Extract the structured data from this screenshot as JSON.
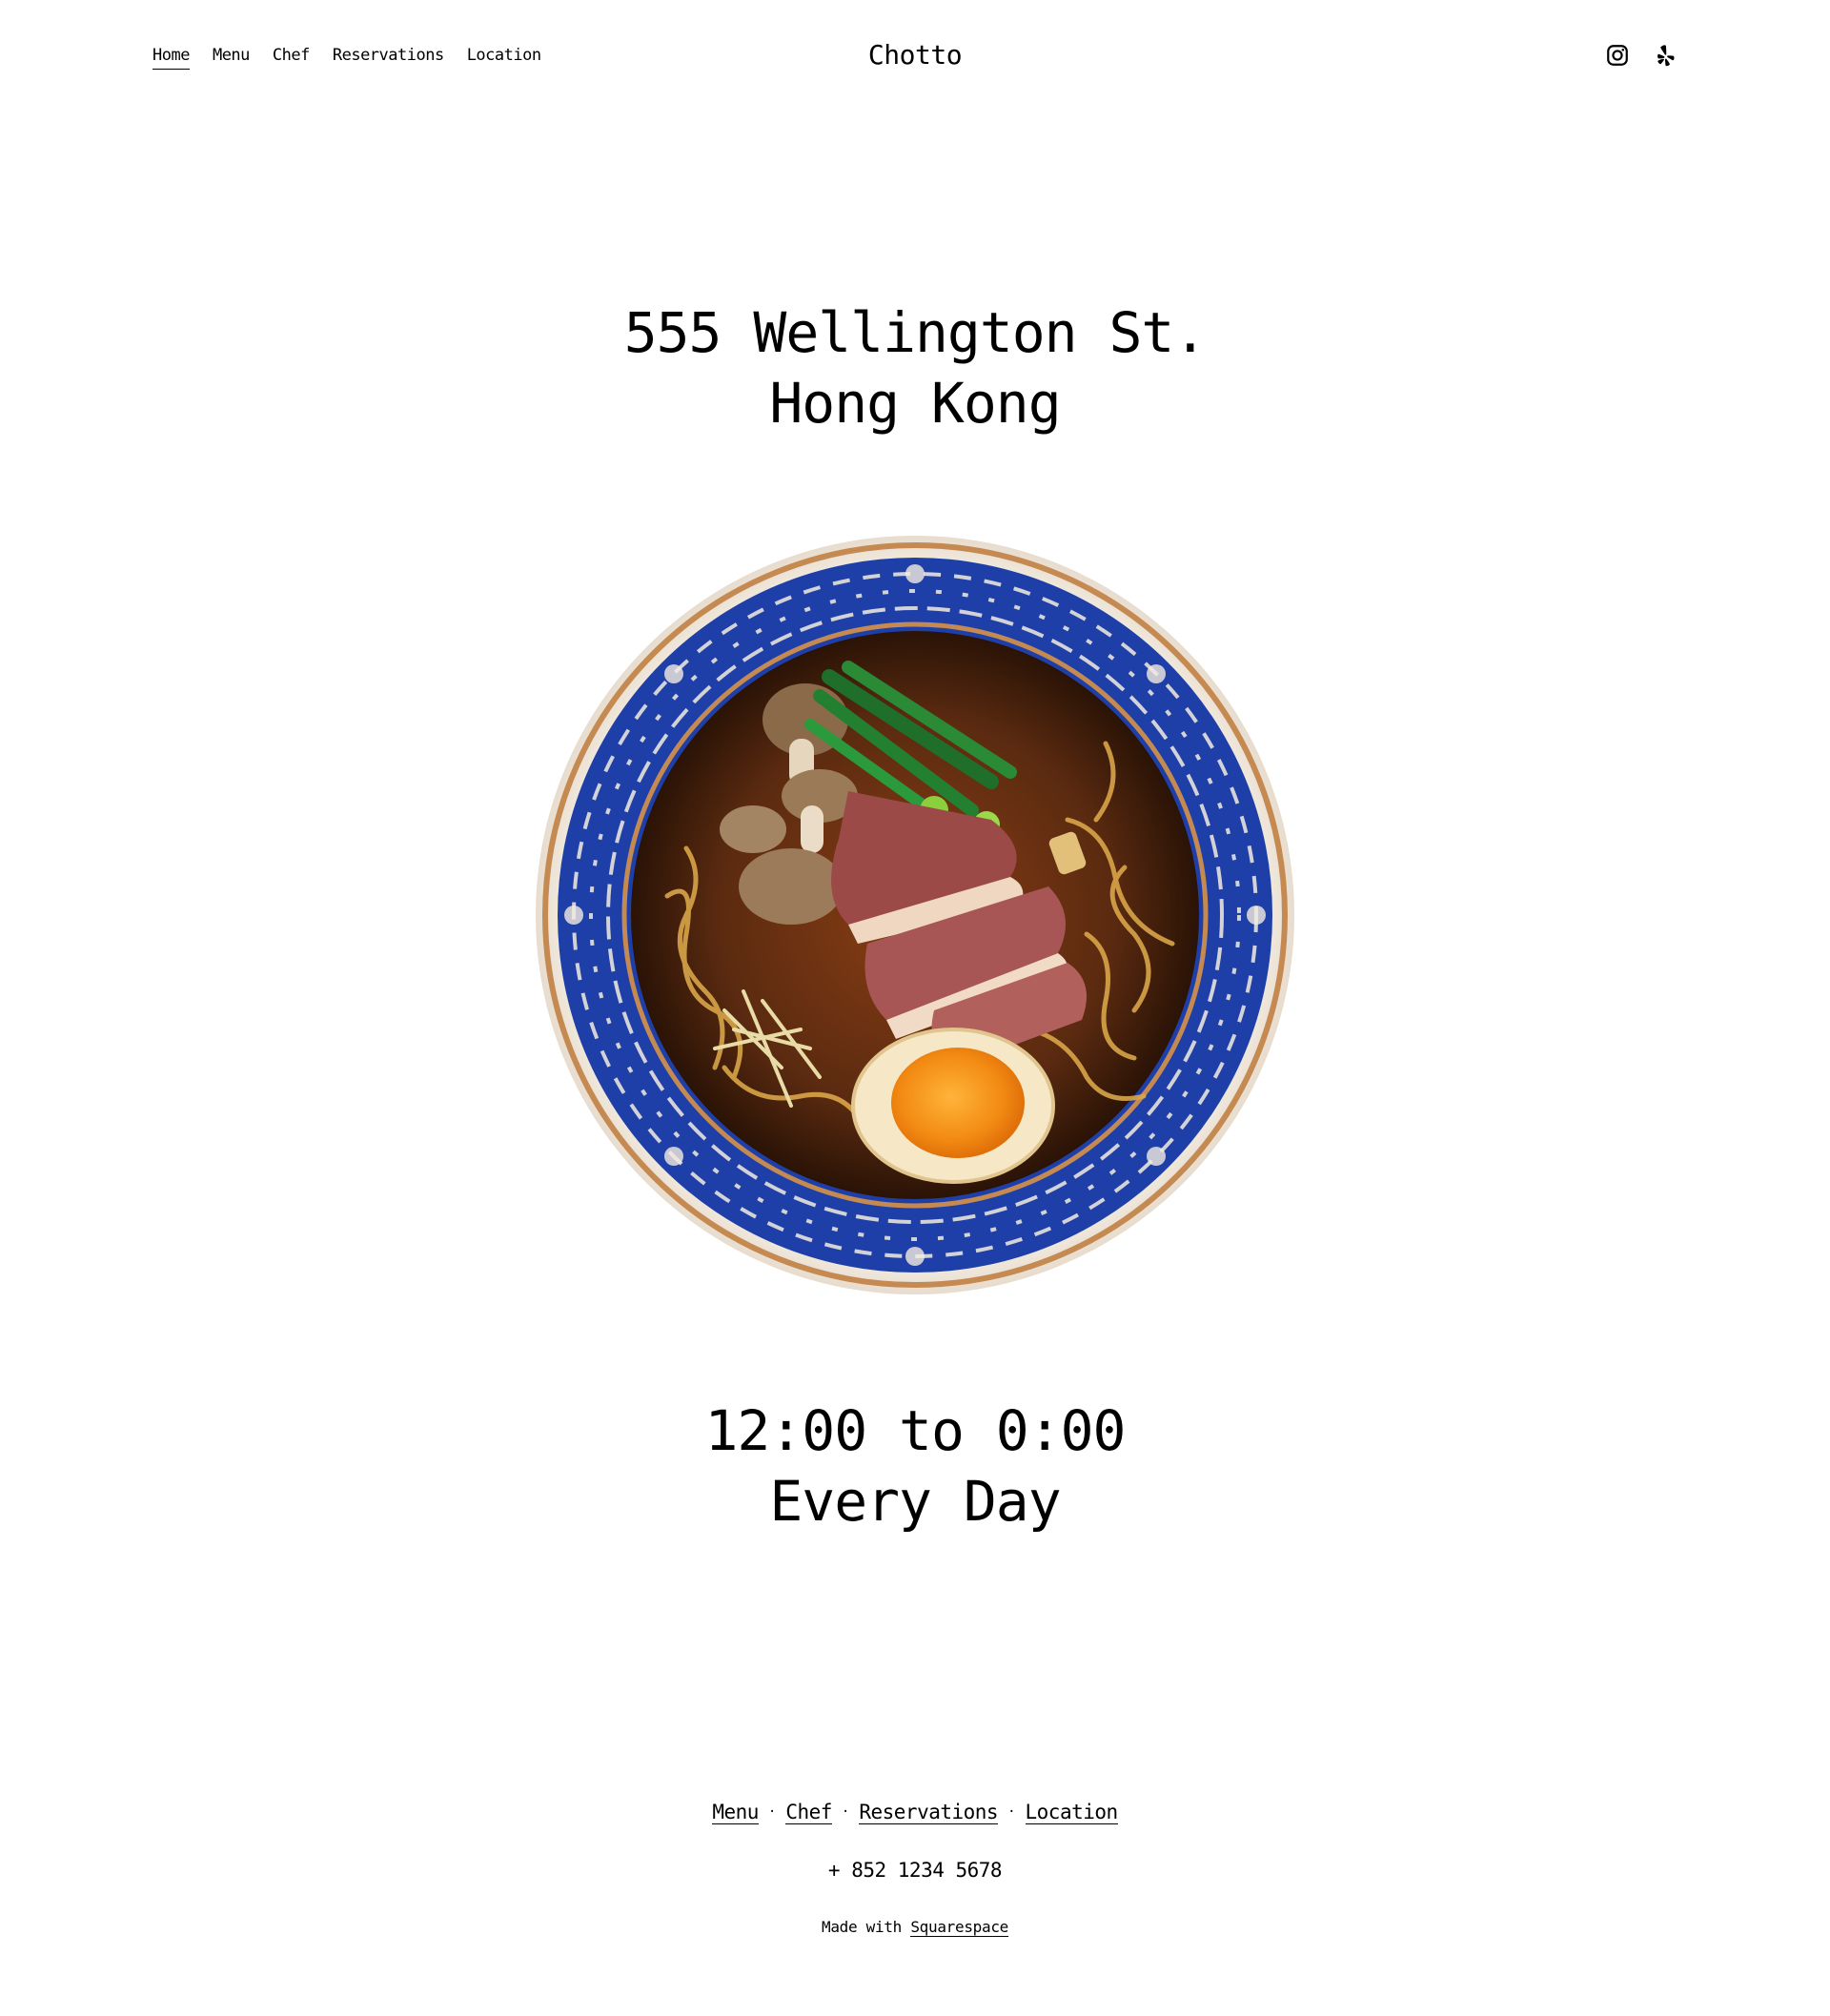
{
  "header": {
    "nav": [
      {
        "label": "Home",
        "active": true
      },
      {
        "label": "Menu",
        "active": false
      },
      {
        "label": "Chef",
        "active": false
      },
      {
        "label": "Reservations",
        "active": false
      },
      {
        "label": "Location",
        "active": false
      }
    ],
    "site_title": "Chotto",
    "social": [
      {
        "icon": "instagram-icon"
      },
      {
        "icon": "yelp-icon"
      }
    ]
  },
  "hero": {
    "address_line1": "555 Wellington St.",
    "address_line2": "Hong Kong"
  },
  "image": {
    "subject": "ramen-bowl"
  },
  "hours": {
    "line1": "12:00 to 0:00",
    "line2": "Every Day"
  },
  "footer": {
    "nav": [
      "Menu",
      "Chef",
      "Reservations",
      "Location"
    ],
    "separator": "·",
    "phone": "+ 852 1234 5678",
    "made_with_prefix": "Made with",
    "made_with_link": "Squarespace"
  },
  "colors": {
    "text": "#000000",
    "background": "#ffffff",
    "bowl_blue": "#1f3fa8",
    "broth": "#5a2a10",
    "yolk": "#f28a12"
  }
}
